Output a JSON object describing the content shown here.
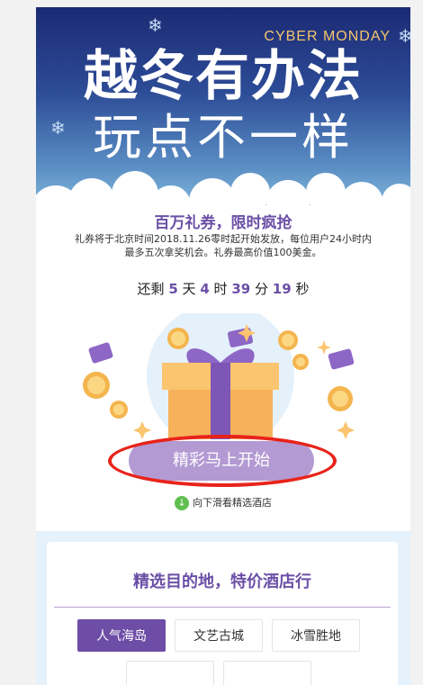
{
  "hero": {
    "brand": "CYBER MONDAY",
    "line1": "越冬有办法",
    "line2": "玩点不一样"
  },
  "promo": {
    "title": "百万礼券，限时疯抢",
    "desc_line1": "礼券将于北京时间2018.11.26零时起开始发放，每位用户24小时内",
    "desc_line2": "最多五次拿奖机会。礼券最高价值100美金。"
  },
  "countdown": {
    "prefix": "还剩",
    "days": "5",
    "days_unit": "天",
    "hours": "4",
    "hours_unit": "时",
    "minutes": "39",
    "minutes_unit": "分",
    "seconds": "19",
    "seconds_unit": "秒"
  },
  "cta": {
    "label": "精彩马上开始"
  },
  "scroll_hint": "向下滑看精选酒店",
  "section": {
    "title": "精选目的地，特价酒店行",
    "tabs": [
      "人气海岛",
      "文艺古城",
      "冰雪胜地"
    ],
    "active_tab": "人气海岛"
  },
  "icons": {
    "snowflake": "snowflake-icon",
    "coin": "coin-icon",
    "ticket": "discount-ticket-icon",
    "sparkle": "sparkle-icon",
    "gift": "gift-box-icon",
    "arrow": "arrow-down-circle-icon"
  },
  "colors": {
    "accent": "#6b4fa6",
    "button": "#b39ad3",
    "highlight": "#e8231a",
    "brand_text": "#f6c56c"
  }
}
